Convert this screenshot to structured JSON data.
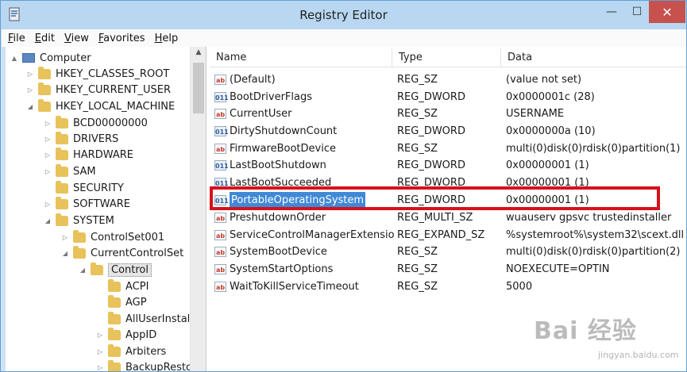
{
  "window": {
    "title": "Registry Editor",
    "controls": {
      "minimize": "—",
      "maximize": "☐",
      "close": "✕"
    }
  },
  "menu": [
    "File",
    "Edit",
    "View",
    "Favorites",
    "Help"
  ],
  "tree": {
    "nodes": [
      {
        "label": "Computer",
        "toggle": "▲",
        "icon": "computer"
      },
      {
        "label": "HKEY_CLASSES_ROOT",
        "toggle": "▷",
        "icon": "folder"
      },
      {
        "label": "HKEY_CURRENT_USER",
        "toggle": "▷",
        "icon": "folder"
      },
      {
        "label": "HKEY_LOCAL_MACHINE",
        "toggle": "◢",
        "icon": "folder"
      },
      {
        "label": "BCD00000000",
        "toggle": "▷",
        "icon": "folder"
      },
      {
        "label": "DRIVERS",
        "toggle": "▷",
        "icon": "folder"
      },
      {
        "label": "HARDWARE",
        "toggle": "▷",
        "icon": "folder"
      },
      {
        "label": "SAM",
        "toggle": "▷",
        "icon": "folder"
      },
      {
        "label": "SECURITY",
        "toggle": "",
        "icon": "folder"
      },
      {
        "label": "SOFTWARE",
        "toggle": "▷",
        "icon": "folder"
      },
      {
        "label": "SYSTEM",
        "toggle": "◢",
        "icon": "folder"
      },
      {
        "label": "ControlSet001",
        "toggle": "▷",
        "icon": "folder"
      },
      {
        "label": "CurrentControlSet",
        "toggle": "◢",
        "icon": "folder"
      },
      {
        "label": "Control",
        "toggle": "◢",
        "icon": "folder",
        "selected": true
      },
      {
        "label": "ACPI",
        "toggle": "",
        "icon": "folder"
      },
      {
        "label": "AGP",
        "toggle": "",
        "icon": "folder"
      },
      {
        "label": "AllUserInstal",
        "toggle": "",
        "icon": "folder"
      },
      {
        "label": "AppID",
        "toggle": "▷",
        "icon": "folder"
      },
      {
        "label": "Arbiters",
        "toggle": "▷",
        "icon": "folder"
      },
      {
        "label": "BackupResto",
        "toggle": "▷",
        "icon": "folder"
      }
    ]
  },
  "list": {
    "columns": [
      "Name",
      "Type",
      "Data"
    ],
    "rows": [
      {
        "name": "(Default)",
        "type": "REG_SZ",
        "data": "(value not set)",
        "icon": "sz"
      },
      {
        "name": "BootDriverFlags",
        "type": "REG_DWORD",
        "data": "0x0000001c (28)",
        "icon": "bin"
      },
      {
        "name": "CurrentUser",
        "type": "REG_SZ",
        "data": "USERNAME",
        "icon": "sz"
      },
      {
        "name": "DirtyShutdownCount",
        "type": "REG_DWORD",
        "data": "0x0000000a (10)",
        "icon": "bin"
      },
      {
        "name": "FirmwareBootDevice",
        "type": "REG_SZ",
        "data": "multi(0)disk(0)rdisk(0)partition(1)",
        "icon": "sz"
      },
      {
        "name": "LastBootShutdown",
        "type": "REG_DWORD",
        "data": "0x00000001 (1)",
        "icon": "bin"
      },
      {
        "name": "LastBootSucceeded",
        "type": "REG_DWORD",
        "data": "0x00000001 (1)",
        "icon": "bin"
      },
      {
        "name": "PortableOperatingSystem",
        "type": "REG_DWORD",
        "data": "0x00000001 (1)",
        "icon": "bin",
        "selected": true
      },
      {
        "name": "PreshutdownOrder",
        "type": "REG_MULTI_SZ",
        "data": "wuauserv gpsvc trustedinstaller",
        "icon": "sz"
      },
      {
        "name": "ServiceControlManagerExtension",
        "type": "REG_EXPAND_SZ",
        "data": "%systemroot%\\system32\\scext.dll",
        "icon": "sz"
      },
      {
        "name": "SystemBootDevice",
        "type": "REG_SZ",
        "data": "multi(0)disk(0)rdisk(0)partition(2)",
        "icon": "sz"
      },
      {
        "name": "SystemStartOptions",
        "type": "REG_SZ",
        "data": " NOEXECUTE=OPTIN",
        "icon": "sz"
      },
      {
        "name": "WaitToKillServiceTimeout",
        "type": "REG_SZ",
        "data": "5000",
        "icon": "sz"
      }
    ]
  },
  "icon_labels": {
    "sz": "ab",
    "bin": "011"
  },
  "watermark": {
    "brand": "Bai 经验",
    "url": "jingyan.baidu.com"
  },
  "colors": {
    "highlight": "#d4121c",
    "selection": "#3f89d6",
    "close": "#c7514d"
  }
}
